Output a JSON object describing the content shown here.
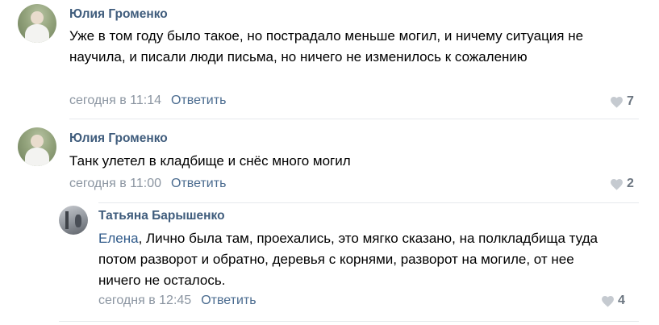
{
  "comments": [
    {
      "author": "Юлия Громенко",
      "text": "Уже в том году было такое, но пострадало меньше могил, и ничему ситуация не научила, и писали люди письма, но ничего не изменилось к сожалению",
      "time": "сегодня в 11:14",
      "reply_label": "Ответить",
      "likes": "7"
    },
    {
      "author": "Юлия Громенко",
      "text": "Танк улетел в кладбище и снёс много могил",
      "time": "сегодня в 11:00",
      "reply_label": "Ответить",
      "likes": "2"
    },
    {
      "author": "Татьяна Барышенко",
      "mention": "Елена",
      "text": ", Лично была там, проехались, это мягко сказано, на полкладбища туда потом разворот и обратно, деревья с корнями, разворот на могиле, от нее ничего не осталось.",
      "time": "сегодня в 12:45",
      "reply_label": "Ответить",
      "likes": "4"
    }
  ],
  "icons": {
    "like": "heart-icon"
  },
  "colors": {
    "author": "#3f5c7c",
    "mention": "#2f5a8a",
    "meta": "#8b95a1",
    "reply": "#4a6b8f",
    "heart": "#c5cad0"
  }
}
